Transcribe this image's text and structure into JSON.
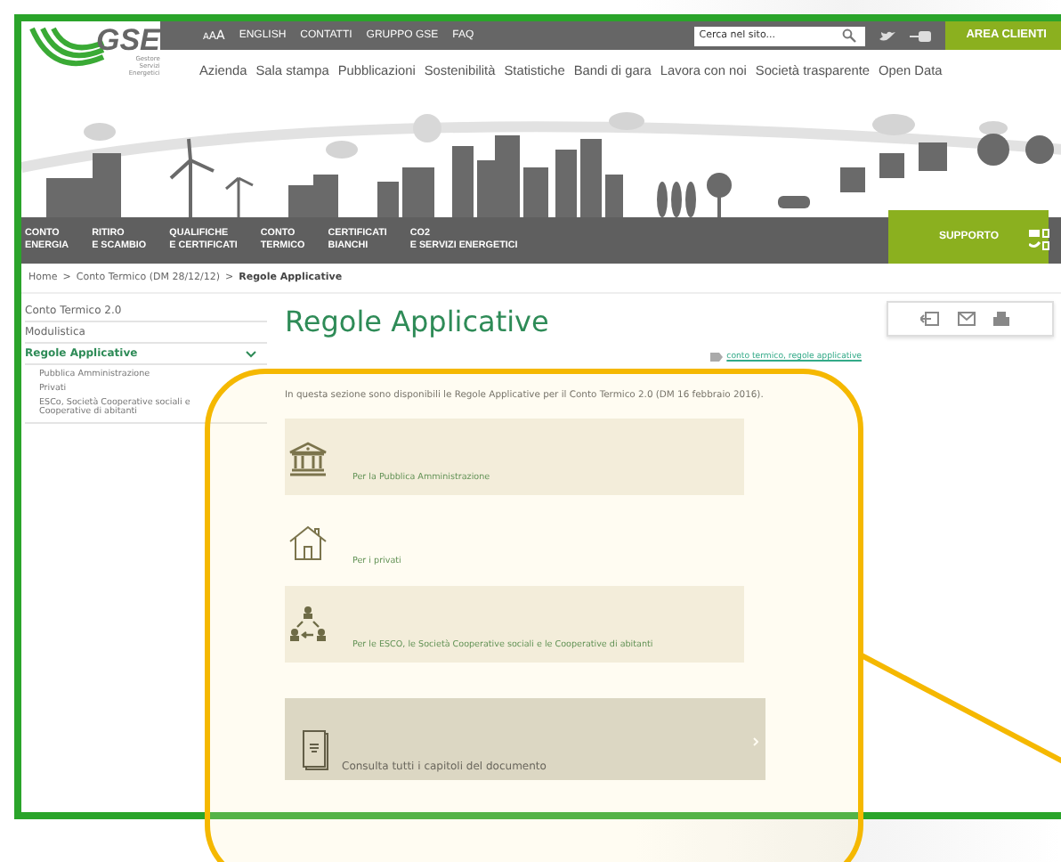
{
  "header": {
    "logo": {
      "text": "GSE",
      "subtitle": [
        "Gestore",
        "Servizi",
        "Energetici"
      ]
    },
    "text_size": [
      "A",
      "A",
      "A"
    ],
    "top_links": [
      "ENGLISH",
      "CONTATTI",
      "GRUPPO GSE",
      "FAQ"
    ],
    "search": {
      "placeholder": "Cerca nel sito..."
    },
    "area_clienti": "AREA CLIENTI",
    "main_nav": [
      "Azienda",
      "Sala stampa",
      "Pubblicazioni",
      "Sostenibilità",
      "Statistiche",
      "Bandi di gara",
      "Lavora con noi",
      "Società trasparente",
      "Open Data"
    ]
  },
  "section_nav": [
    {
      "lines": [
        "CONTO",
        "ENERGIA"
      ]
    },
    {
      "lines": [
        "RITIRO",
        "E SCAMBIO"
      ]
    },
    {
      "lines": [
        "QUALIFICHE",
        "E CERTIFICATI"
      ]
    },
    {
      "lines": [
        "CONTO",
        "TERMICO"
      ]
    },
    {
      "lines": [
        "CERTIFICATI",
        "BIANCHI"
      ]
    },
    {
      "lines": [
        "CO2",
        "E SERVIZI ENERGETICI"
      ]
    }
  ],
  "support": "SUPPORTO",
  "breadcrumb": {
    "separator": ">",
    "items": [
      "Home",
      "Conto Termico (DM 28/12/12)",
      "Regole Applicative"
    ]
  },
  "sidebar": {
    "items": [
      {
        "label": "Conto Termico 2.0",
        "selected": false,
        "expanded": false
      },
      {
        "label": "Modulistica",
        "selected": false,
        "expanded": false
      },
      {
        "label": "Regole Applicative",
        "selected": true,
        "expanded": true,
        "children": [
          {
            "label": "Pubblica Amministrazione"
          },
          {
            "label": "Privati"
          },
          {
            "label": "ESCo, Società Cooperative sociali e Cooperative di abitanti"
          }
        ]
      }
    ]
  },
  "page": {
    "title": "Regole Applicative",
    "tags": "conto termico, regole applicative",
    "intro": "In questa sezione sono disponibili le Regole Applicative per il Conto Termico 2.0 (DM 16 febbraio 2016).",
    "cards": [
      {
        "kind": "institution",
        "label": "Per la Pubblica Amministrazione",
        "shaded": true
      },
      {
        "kind": "house",
        "label": "Per i privati",
        "shaded": false
      },
      {
        "kind": "network",
        "label": "Per le ESCO, le Società Cooperative sociali e le Cooperative di abitanti",
        "shaded": true
      }
    ],
    "document_button": "Consulta tutti i capitoli del documento"
  }
}
